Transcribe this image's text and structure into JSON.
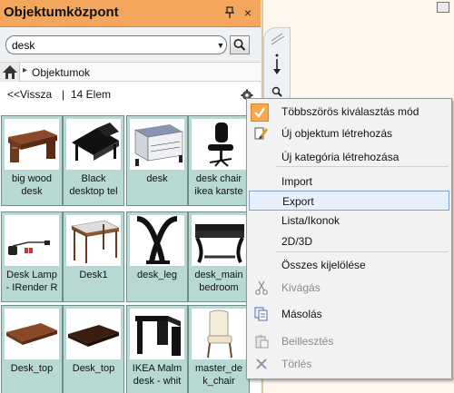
{
  "panel": {
    "title": "Objektumközpont",
    "pin_label": " ▣",
    "close_label": "×"
  },
  "search": {
    "value": "desk",
    "placeholder": ""
  },
  "breadcrumb": {
    "label": "Objektumok"
  },
  "nav": {
    "back_label": "<<Vissza",
    "separator": "|",
    "count_label": "14 Elem"
  },
  "items": [
    {
      "label": "big wood\ndesk",
      "icon": "wood-desk"
    },
    {
      "label": "Black\ndesktop tel",
      "icon": "black-desk"
    },
    {
      "label": "desk",
      "icon": "metal-desk"
    },
    {
      "label": "desk chair\nikea karste",
      "icon": "office-chair"
    },
    {
      "label": "Desk Lamp\n- IRender R",
      "icon": "desk-lamp"
    },
    {
      "label": "Desk1",
      "icon": "small-desk"
    },
    {
      "label": "desk_leg",
      "icon": "desk-leg"
    },
    {
      "label": "desk_main\nbedroom",
      "icon": "bedroom-desk"
    },
    {
      "label": "Desk_top",
      "icon": "desk-top-1"
    },
    {
      "label": "Desk_top",
      "icon": "desk-top-2"
    },
    {
      "label": "IKEA Malm\ndesk - whit",
      "icon": "malm-desk"
    },
    {
      "label": "master_de\nk_chair",
      "icon": "master-chair"
    }
  ],
  "menu": {
    "items": [
      {
        "label": "Többszörös kiválasztás mód",
        "icon": "checkmark-icon",
        "checked": true
      },
      {
        "label": "Új objektum létrehozás",
        "icon": "new-object-icon"
      },
      {
        "label": "Új kategória létrehozása",
        "icon": ""
      },
      {
        "label": "Import",
        "icon": ""
      },
      {
        "label": "Export",
        "icon": "",
        "highlighted": true
      },
      {
        "label": "Lista/Ikonok",
        "icon": ""
      },
      {
        "label": "2D/3D",
        "icon": ""
      },
      {
        "label": "Összes kijelölése",
        "icon": ""
      },
      {
        "label": "Kivágás",
        "icon": "scissors-icon",
        "disabled": true
      },
      {
        "label": "Másolás",
        "icon": "copy-icon"
      },
      {
        "label": "Beillesztés",
        "icon": "paste-icon",
        "disabled": true
      },
      {
        "label": "Törlés",
        "icon": "delete-icon",
        "disabled": true
      }
    ]
  },
  "colors": {
    "titlebar": "#f3a75c",
    "tile": "#b8d8d3",
    "menu_highlight": "#e5f0fb",
    "check_bg": "#f5a94a"
  }
}
